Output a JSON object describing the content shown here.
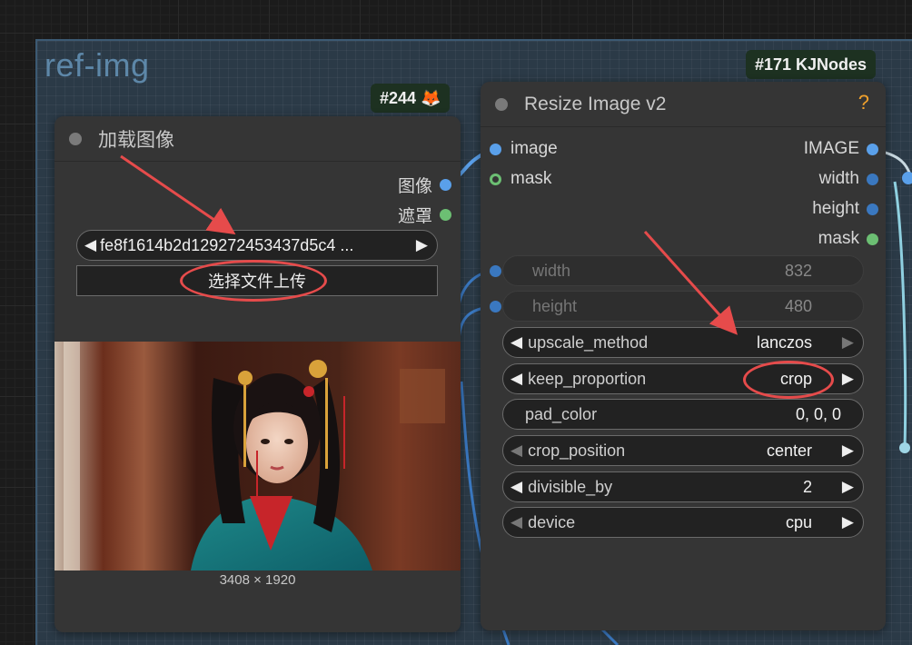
{
  "group": {
    "title": "ref-img"
  },
  "badges": {
    "load_node": "#244 🦊",
    "resize_node": "#171 KJNodes"
  },
  "load_node": {
    "title": "加载图像",
    "outputs": [
      "图像",
      "遮罩"
    ],
    "file_value": "fe8f1614b2d129272453437d5c4 ...",
    "upload_label": "选择文件上传",
    "image_caption": "3408 × 1920"
  },
  "resize_node": {
    "title": "Resize Image v2",
    "help_icon": "?",
    "inputs": [
      "image",
      "mask"
    ],
    "outputs": [
      "IMAGE",
      "width",
      "height",
      "mask"
    ],
    "widgets": [
      {
        "label": "width",
        "value": "832"
      },
      {
        "label": "height",
        "value": "480"
      },
      {
        "label": "upscale_method",
        "value": "lanczos"
      },
      {
        "label": "keep_proportion",
        "value": "crop"
      },
      {
        "label": "pad_color",
        "value": "0, 0, 0"
      },
      {
        "label": "crop_position",
        "value": "center"
      },
      {
        "label": "divisible_by",
        "value": "2"
      },
      {
        "label": "device",
        "value": "cpu"
      }
    ]
  },
  "colors": {
    "group_bg": "#2b3a47",
    "node_bg": "#353535",
    "image_port": "#5aa0ea",
    "mask_port": "#6cbf73",
    "help": "#f1a12c",
    "annotation": "#e64b4b"
  }
}
